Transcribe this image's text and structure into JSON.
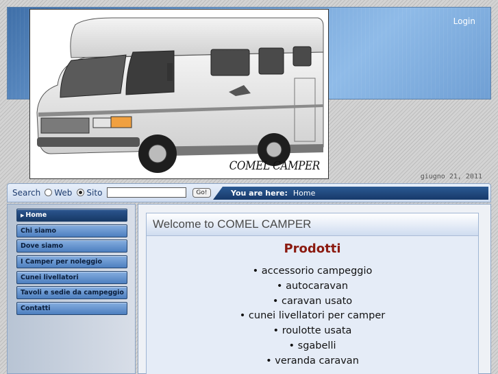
{
  "header": {
    "login_label": "Login",
    "hero_caption": "COMEL CAMPER",
    "date": "giugno 21, 2011"
  },
  "search": {
    "label": "Search",
    "option_web": "Web",
    "option_site": "Sito",
    "selected": "Sito",
    "input_value": "",
    "go_label": "Go!"
  },
  "breadcrumb": {
    "label": "You are here:",
    "current": "Home"
  },
  "nav": {
    "items": [
      {
        "label": "Home",
        "active": true
      },
      {
        "label": "Chi siamo",
        "active": false
      },
      {
        "label": "Dove siamo",
        "active": false
      },
      {
        "label": "I Camper per noleggio",
        "active": false
      },
      {
        "label": "Cunei livellatori",
        "active": false
      },
      {
        "label": "Tavoli e sedie da campeggio",
        "active": false
      },
      {
        "label": "Contatti",
        "active": false
      }
    ]
  },
  "content": {
    "heading": "Welcome to COMEL CAMPER",
    "section_title": "Prodotti",
    "products": [
      "accessorio campeggio",
      "autocaravan",
      "caravan usato",
      "cunei livellatori per camper",
      "roulotte usata",
      "sgabelli",
      "veranda caravan"
    ]
  },
  "colors": {
    "nav_active": "#173966",
    "nav_item": "#6f9bd3",
    "section_title": "#8b1a10",
    "breadcrumb_bar": "#1f4a80"
  }
}
